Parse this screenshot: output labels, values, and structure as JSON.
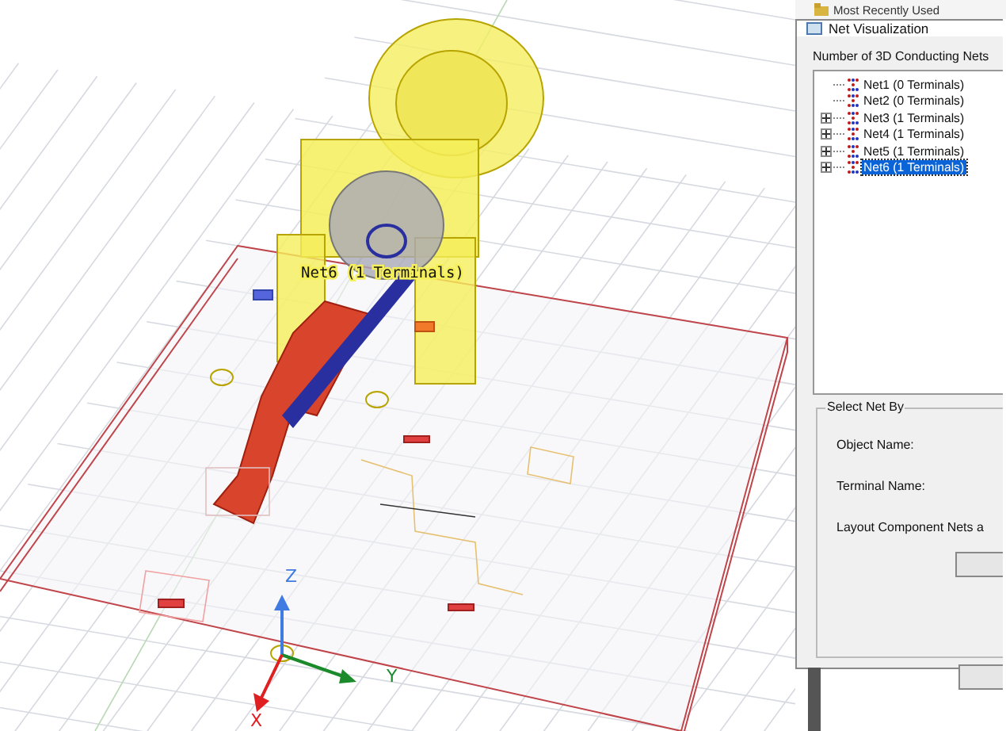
{
  "viewport": {
    "net_label": "Net6 (1 Terminals)",
    "axes": [
      {
        "kind": "z",
        "label": "Z"
      },
      {
        "kind": "y",
        "label": "Y"
      },
      {
        "kind": "x",
        "label": "X"
      }
    ]
  },
  "background_tree": {
    "item": "Most Recently Used"
  },
  "dialog": {
    "title": "Net Visualization",
    "list_label": "Number of 3D Conducting Nets",
    "nets": [
      {
        "label": "Net1 (0 Terminals)",
        "expandable": false,
        "selected": false
      },
      {
        "label": "Net2 (0 Terminals)",
        "expandable": false,
        "selected": false
      },
      {
        "label": "Net3 (1 Terminals)",
        "expandable": true,
        "selected": false
      },
      {
        "label": "Net4 (1 Terminals)",
        "expandable": true,
        "selected": false
      },
      {
        "label": "Net5 (1 Terminals)",
        "expandable": true,
        "selected": false
      },
      {
        "label": "Net6 (1 Terminals)",
        "expandable": true,
        "selected": true
      }
    ],
    "group": {
      "title": "Select Net By",
      "fields": [
        "Object Name:",
        "Terminal Name:",
        "Layout Component Nets a"
      ]
    }
  }
}
